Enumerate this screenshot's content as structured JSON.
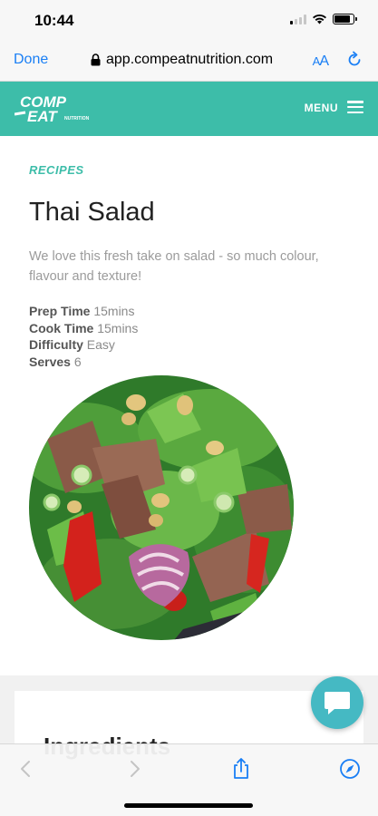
{
  "status_bar": {
    "time": "10:44",
    "battery_level": 0.85
  },
  "browser": {
    "done_label": "Done",
    "url": "app.compeatnutrition.com",
    "aa_label_small": "A",
    "aa_label_big": "A"
  },
  "site": {
    "logo_line1": "COMP",
    "logo_line2": "EAT",
    "logo_sub": "NUTRITION",
    "menu_label": "MENU",
    "brand_color": "#3dbda9"
  },
  "recipe": {
    "category": "RECIPES",
    "title": "Thai Salad",
    "description": "We love this fresh take on salad - so much colour, flavour and texture!",
    "meta": {
      "prep_label": "Prep Time",
      "prep_value": "15mins",
      "cook_label": "Cook Time",
      "cook_value": "15mins",
      "difficulty_label": "Difficulty",
      "difficulty_value": "Easy",
      "serves_label": "Serves",
      "serves_value": "6"
    }
  },
  "ingredients_heading": "Ingredients",
  "accent_blue": "#1a7ff5",
  "chat_color": "#45b9c3"
}
